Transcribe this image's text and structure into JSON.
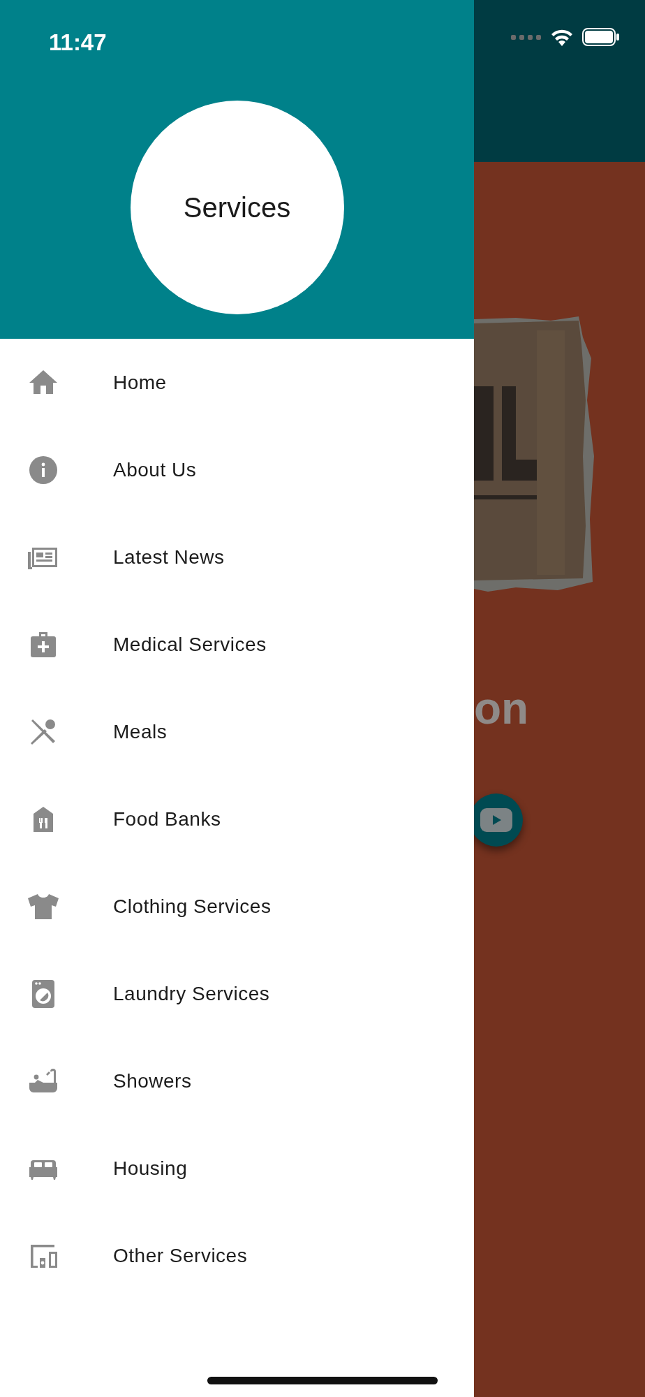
{
  "status_bar": {
    "time": "11:47"
  },
  "drawer": {
    "title": "Services",
    "items": [
      {
        "label": "Home"
      },
      {
        "label": "About Us"
      },
      {
        "label": "Latest News"
      },
      {
        "label": "Medical Services"
      },
      {
        "label": "Meals"
      },
      {
        "label": "Food Banks"
      },
      {
        "label": "Clothing Services"
      },
      {
        "label": "Laundry Services"
      },
      {
        "label": "Showers"
      },
      {
        "label": "Housing"
      },
      {
        "label": "Other Services"
      }
    ]
  },
  "background_page": {
    "heading": "on"
  }
}
